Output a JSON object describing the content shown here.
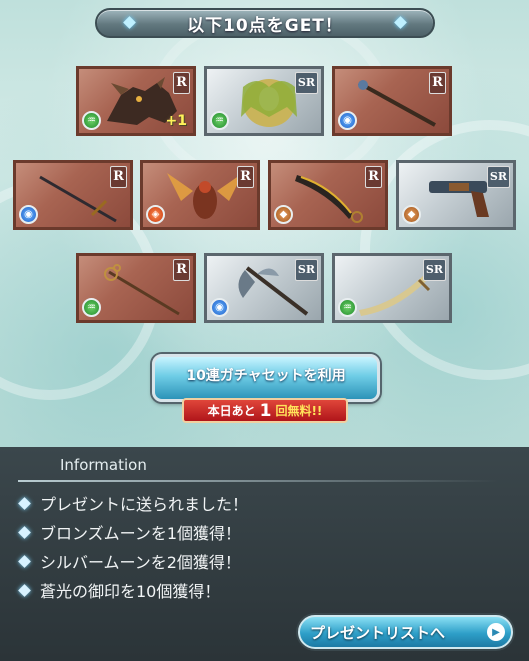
{
  "header": {
    "title": "以下10点をGET！"
  },
  "items": [
    {
      "rarity": "R",
      "element": "wind",
      "plus": "+1",
      "kind": "summon-beast"
    },
    {
      "rarity": "SR",
      "element": "wind",
      "plus": "",
      "kind": "summon-maiden"
    },
    {
      "rarity": "R",
      "element": "water",
      "plus": "",
      "kind": "staff"
    },
    {
      "rarity": "R",
      "element": "water",
      "plus": "",
      "kind": "dagger"
    },
    {
      "rarity": "R",
      "element": "fire",
      "plus": "",
      "kind": "summon-insect"
    },
    {
      "rarity": "R",
      "element": "earth",
      "plus": "",
      "kind": "scimitar"
    },
    {
      "rarity": "SR",
      "element": "earth",
      "plus": "",
      "kind": "gun"
    },
    {
      "rarity": "R",
      "element": "wind",
      "plus": "",
      "kind": "staff-ornate"
    },
    {
      "rarity": "SR",
      "element": "water",
      "plus": "",
      "kind": "axe"
    },
    {
      "rarity": "SR",
      "element": "wind",
      "plus": "",
      "kind": "sword-curved"
    }
  ],
  "gacha": {
    "button_label": "10連ガチャセットを利用",
    "free_prefix": "本日あと",
    "free_count": "1",
    "free_suffix": "回無料!!"
  },
  "info": {
    "title": "Information",
    "lines": [
      "プレゼントに送られました！",
      "ブロンズムーンを1個獲得！",
      "シルバームーンを2個獲得！",
      "蒼光の御印を10個獲得！"
    ]
  },
  "present_button": {
    "label": "プレゼントリストへ"
  }
}
